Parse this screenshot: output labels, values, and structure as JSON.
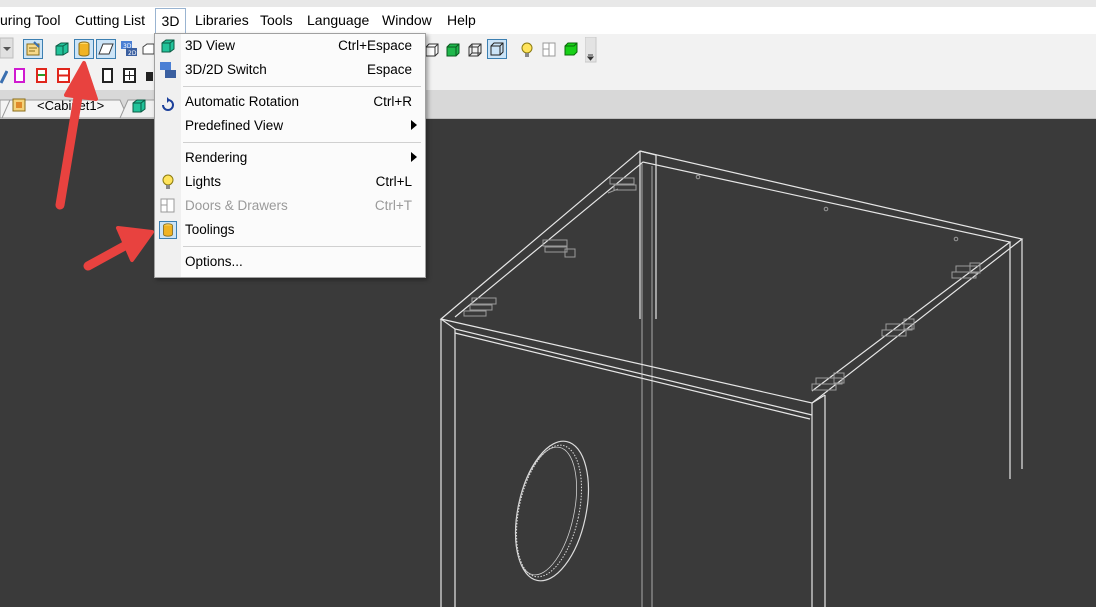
{
  "menubar": {
    "items": [
      "uring Tool",
      "Cutting List",
      "3D",
      "Libraries",
      "Tools",
      "Language",
      "Window",
      "Help"
    ],
    "active": "3D"
  },
  "tabs": {
    "cabinet": "<Cabinet1>"
  },
  "dropdown": {
    "items": [
      {
        "label": "3D View",
        "shortcut": "Ctrl+Espace",
        "icon": "3d-view-icon",
        "enabled": true
      },
      {
        "label": "3D/2D Switch",
        "shortcut": "Espace",
        "icon": "3d-2d-switch-icon",
        "enabled": true
      },
      {
        "label": "Automatic Rotation",
        "shortcut": "Ctrl+R",
        "icon": "auto-rotation-icon",
        "enabled": true
      },
      {
        "label": "Predefined View",
        "shortcut": "",
        "icon": "",
        "enabled": true,
        "submenu": true
      },
      {
        "label": "Rendering",
        "shortcut": "",
        "icon": "",
        "enabled": true,
        "submenu": true
      },
      {
        "label": "Lights",
        "shortcut": "Ctrl+L",
        "icon": "lightbulb-icon",
        "enabled": true
      },
      {
        "label": "Doors & Drawers",
        "shortcut": "Ctrl+T",
        "icon": "doors-drawers-icon",
        "enabled": false
      },
      {
        "label": "Toolings",
        "shortcut": "",
        "icon": "toolings-icon",
        "enabled": true,
        "checked": true
      },
      {
        "label": "Options...",
        "shortcut": "",
        "icon": "",
        "enabled": true
      }
    ]
  },
  "colors": {
    "viewport_bg": "#3a3a3a",
    "annotation_arrow": "#e8423f",
    "highlight_border": "#3c7fb1",
    "highlight_fill": "#cce4f7",
    "wireframe": "#e6e6e6"
  }
}
